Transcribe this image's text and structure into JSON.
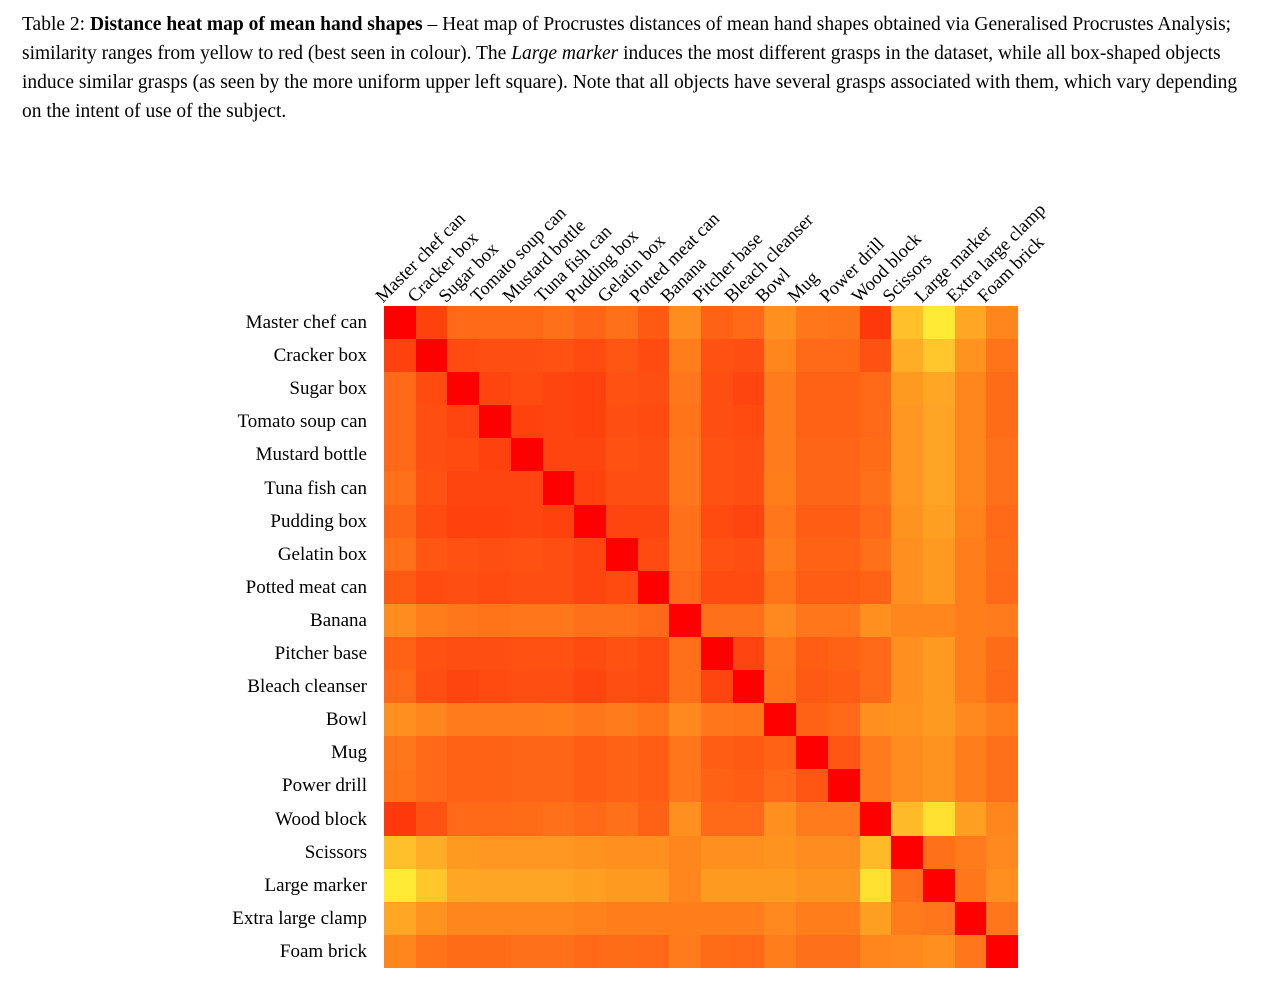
{
  "caption": {
    "label": "Table 2:",
    "title": "Distance heat map of mean hand shapes",
    "dash": " – ",
    "body_1": "Heat map of Procrustes distances of mean hand shapes obtained via Generalised Procrustes Analysis; similarity ranges from yellow to red (best seen in colour). The ",
    "emphasis": "Large marker",
    "body_2": " induces the most different grasps in the dataset, while all box-shaped objects induce similar grasps (as seen by the more uniform upper left square). Note that all objects have several grasps associated with them, which vary depending on the intent of use of the subject."
  },
  "chart_data": {
    "type": "heatmap",
    "title": "Distance heat map of mean hand shapes",
    "xlabel": "",
    "ylabel": "",
    "colormap": "autumn (yellow = similar/low, red = dissimilar/high, reversed)",
    "colormap_low_color": "#ff0000",
    "colormap_high_color": "#ffff33",
    "grid": false,
    "legend": "none",
    "symmetric": true,
    "diagonal_value": 0,
    "value_range": [
      0,
      1
    ],
    "categories": [
      "Master chef can",
      "Cracker box",
      "Sugar box",
      "Tomato soup can",
      "Mustard bottle",
      "Tuna fish can",
      "Pudding box",
      "Gelatin box",
      "Potted meat can",
      "Banana",
      "Pitcher base",
      "Bleach cleanser",
      "Bowl",
      "Mug",
      "Power drill",
      "Wood block",
      "Scissors",
      "Large marker",
      "Extra large clamp",
      "Foam brick"
    ],
    "x_tick_labels": [
      "Master chef can",
      "Cracker box",
      "Sugar box",
      "Tomato soup can",
      "Mustard bottle",
      "Tuna fish can",
      "Pudding box",
      "Gelatin box",
      "Potted meat can",
      "Banana",
      "Pitcher base",
      "Bleach cleanser",
      "Bowl",
      "Mug",
      "Power drill",
      "Wood block",
      "Scissors",
      "Large marker",
      "Extra large clamp",
      "Foam brick"
    ],
    "y_tick_labels": [
      "Master chef can",
      "Cracker box",
      "Sugar box",
      "Tomato soup can",
      "Mustard bottle",
      "Tuna fish can",
      "Pudding box",
      "Gelatin box",
      "Potted meat can",
      "Banana",
      "Pitcher base",
      "Bleach cleanser",
      "Bowl",
      "Mug",
      "Power drill",
      "Wood block",
      "Scissors",
      "Large marker",
      "Extra large clamp",
      "Foam brick"
    ],
    "values": [
      [
        0.0,
        0.12,
        0.22,
        0.22,
        0.22,
        0.24,
        0.21,
        0.24,
        0.18,
        0.32,
        0.2,
        0.22,
        0.33,
        0.26,
        0.25,
        0.1,
        0.48,
        0.62,
        0.4,
        0.3
      ],
      [
        0.12,
        0.0,
        0.14,
        0.15,
        0.15,
        0.16,
        0.14,
        0.17,
        0.14,
        0.28,
        0.16,
        0.15,
        0.3,
        0.22,
        0.22,
        0.16,
        0.42,
        0.5,
        0.34,
        0.25
      ],
      [
        0.22,
        0.14,
        0.0,
        0.13,
        0.14,
        0.13,
        0.12,
        0.16,
        0.15,
        0.26,
        0.15,
        0.13,
        0.27,
        0.2,
        0.2,
        0.22,
        0.36,
        0.4,
        0.3,
        0.23
      ],
      [
        0.22,
        0.15,
        0.13,
        0.0,
        0.12,
        0.13,
        0.12,
        0.15,
        0.14,
        0.25,
        0.15,
        0.14,
        0.27,
        0.2,
        0.2,
        0.22,
        0.35,
        0.39,
        0.3,
        0.23
      ],
      [
        0.22,
        0.15,
        0.14,
        0.12,
        0.0,
        0.13,
        0.13,
        0.16,
        0.15,
        0.26,
        0.16,
        0.15,
        0.27,
        0.21,
        0.21,
        0.23,
        0.35,
        0.39,
        0.3,
        0.24
      ],
      [
        0.24,
        0.16,
        0.13,
        0.13,
        0.13,
        0.0,
        0.12,
        0.15,
        0.15,
        0.26,
        0.16,
        0.15,
        0.28,
        0.21,
        0.21,
        0.24,
        0.35,
        0.39,
        0.3,
        0.24
      ],
      [
        0.21,
        0.14,
        0.12,
        0.12,
        0.13,
        0.12,
        0.0,
        0.13,
        0.13,
        0.24,
        0.14,
        0.13,
        0.26,
        0.19,
        0.19,
        0.22,
        0.34,
        0.38,
        0.29,
        0.22
      ],
      [
        0.24,
        0.17,
        0.16,
        0.15,
        0.16,
        0.15,
        0.13,
        0.0,
        0.14,
        0.24,
        0.16,
        0.15,
        0.27,
        0.2,
        0.2,
        0.24,
        0.33,
        0.36,
        0.28,
        0.23
      ],
      [
        0.18,
        0.14,
        0.15,
        0.14,
        0.15,
        0.15,
        0.13,
        0.14,
        0.0,
        0.22,
        0.14,
        0.14,
        0.25,
        0.19,
        0.19,
        0.2,
        0.33,
        0.36,
        0.28,
        0.22
      ],
      [
        0.32,
        0.28,
        0.26,
        0.25,
        0.26,
        0.26,
        0.24,
        0.24,
        0.22,
        0.0,
        0.24,
        0.24,
        0.31,
        0.26,
        0.26,
        0.33,
        0.3,
        0.3,
        0.28,
        0.27
      ],
      [
        0.2,
        0.16,
        0.15,
        0.15,
        0.16,
        0.16,
        0.14,
        0.16,
        0.14,
        0.24,
        0.0,
        0.13,
        0.26,
        0.19,
        0.2,
        0.22,
        0.33,
        0.36,
        0.28,
        0.23
      ],
      [
        0.22,
        0.15,
        0.13,
        0.14,
        0.15,
        0.15,
        0.13,
        0.15,
        0.14,
        0.24,
        0.13,
        0.0,
        0.25,
        0.18,
        0.19,
        0.22,
        0.33,
        0.36,
        0.28,
        0.22
      ],
      [
        0.33,
        0.3,
        0.27,
        0.27,
        0.27,
        0.28,
        0.26,
        0.27,
        0.25,
        0.31,
        0.26,
        0.25,
        0.0,
        0.2,
        0.22,
        0.33,
        0.34,
        0.36,
        0.31,
        0.28
      ],
      [
        0.26,
        0.22,
        0.2,
        0.2,
        0.21,
        0.21,
        0.19,
        0.2,
        0.19,
        0.26,
        0.19,
        0.18,
        0.2,
        0.0,
        0.17,
        0.27,
        0.32,
        0.34,
        0.28,
        0.24
      ],
      [
        0.25,
        0.22,
        0.2,
        0.2,
        0.21,
        0.21,
        0.19,
        0.2,
        0.19,
        0.26,
        0.2,
        0.19,
        0.22,
        0.17,
        0.0,
        0.27,
        0.32,
        0.34,
        0.28,
        0.24
      ],
      [
        0.1,
        0.16,
        0.22,
        0.22,
        0.23,
        0.24,
        0.22,
        0.24,
        0.2,
        0.33,
        0.22,
        0.22,
        0.33,
        0.27,
        0.27,
        0.0,
        0.46,
        0.58,
        0.38,
        0.3
      ],
      [
        0.48,
        0.42,
        0.36,
        0.35,
        0.35,
        0.35,
        0.34,
        0.33,
        0.33,
        0.3,
        0.33,
        0.33,
        0.34,
        0.32,
        0.32,
        0.46,
        0.0,
        0.24,
        0.27,
        0.31
      ],
      [
        0.62,
        0.5,
        0.4,
        0.39,
        0.39,
        0.39,
        0.38,
        0.36,
        0.36,
        0.3,
        0.36,
        0.36,
        0.36,
        0.34,
        0.34,
        0.58,
        0.24,
        0.0,
        0.26,
        0.33
      ],
      [
        0.4,
        0.34,
        0.3,
        0.3,
        0.3,
        0.3,
        0.29,
        0.28,
        0.28,
        0.28,
        0.28,
        0.28,
        0.31,
        0.28,
        0.28,
        0.38,
        0.27,
        0.26,
        0.0,
        0.26
      ],
      [
        0.3,
        0.25,
        0.23,
        0.23,
        0.24,
        0.24,
        0.22,
        0.23,
        0.22,
        0.27,
        0.23,
        0.22,
        0.28,
        0.24,
        0.24,
        0.3,
        0.31,
        0.33,
        0.26,
        0.0
      ]
    ]
  }
}
